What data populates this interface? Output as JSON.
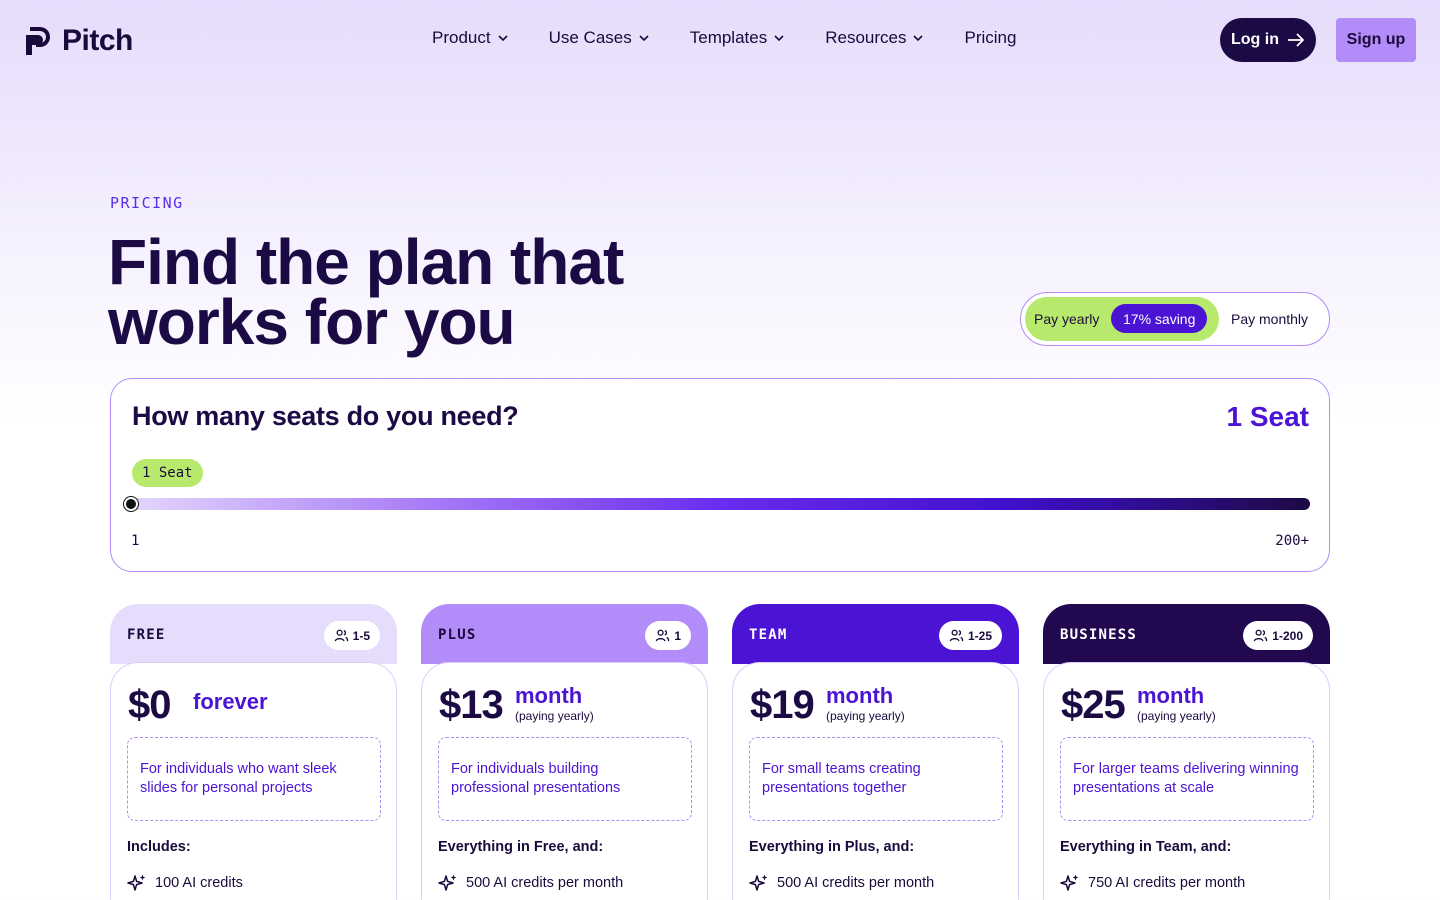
{
  "brand": {
    "name": "Pitch"
  },
  "nav": {
    "items": [
      {
        "label": "Product",
        "dropdown": true
      },
      {
        "label": "Use Cases",
        "dropdown": true
      },
      {
        "label": "Templates",
        "dropdown": true
      },
      {
        "label": "Resources",
        "dropdown": true
      },
      {
        "label": "Pricing",
        "dropdown": false
      }
    ],
    "login_label": "Log in",
    "signup_label": "Sign up"
  },
  "hero": {
    "eyebrow": "PRICING",
    "title_line1": "Find the plan that",
    "title_line2": "works for you"
  },
  "billing": {
    "yearly_label": "Pay yearly",
    "saving_badge": "17% saving",
    "monthly_label": "Pay monthly",
    "selected": "yearly"
  },
  "seats": {
    "question": "How many seats do you need?",
    "count_label": "1 Seat",
    "pill_label": "1 Seat",
    "min_label": "1",
    "max_label": "200+",
    "value": 1
  },
  "plans": [
    {
      "name": "FREE",
      "seats": "1-5",
      "price": "$0",
      "period": "forever",
      "period_note": "",
      "description": "For individuals who want sleek slides for personal projects",
      "includes": "Includes:",
      "feature": "100 AI credits"
    },
    {
      "name": "PLUS",
      "seats": "1",
      "price": "$13",
      "period": "month",
      "period_note": "(paying yearly)",
      "description": "For individuals building professional presentations",
      "includes": "Everything in Free, and:",
      "feature": "500 AI credits per month"
    },
    {
      "name": "TEAM",
      "seats": "1-25",
      "price": "$19",
      "period": "month",
      "period_note": "(paying yearly)",
      "description": "For small teams creating presentations together",
      "includes": "Everything in Plus, and:",
      "feature": "500 AI credits per month"
    },
    {
      "name": "BUSINESS",
      "seats": "1-200",
      "price": "$25",
      "period": "month",
      "period_note": "(paying yearly)",
      "description": "For larger teams delivering winning presentations at scale",
      "includes": "Everything in Team, and:",
      "feature": "750 AI credits per month"
    }
  ],
  "colors": {
    "accent": "#4b14d4",
    "dark": "#1c0a45",
    "lime": "#b7ea6c",
    "lavender": "#b28cf8"
  }
}
